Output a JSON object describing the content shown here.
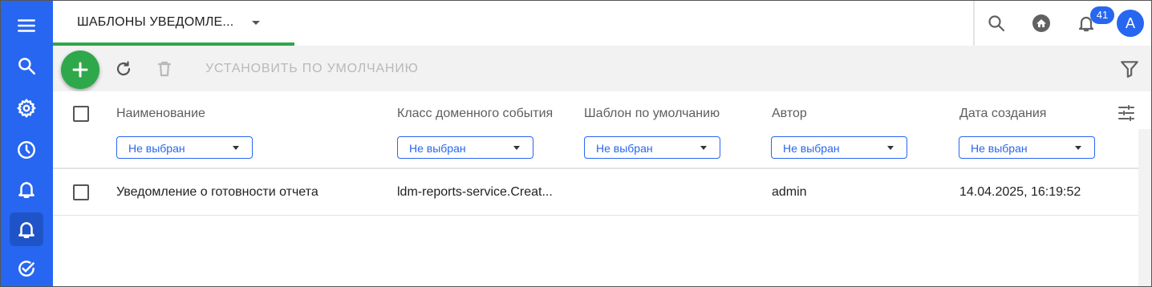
{
  "topbar": {
    "tab_label": "ШАБЛОНЫ УВЕДОМЛЕ...",
    "notification_count": "41",
    "avatar_initial": "A"
  },
  "sidebar": {
    "items": [
      {
        "icon": "menu-icon"
      },
      {
        "icon": "search-icon"
      },
      {
        "icon": "gear-icon"
      },
      {
        "icon": "clock-icon"
      },
      {
        "icon": "bell-icon"
      },
      {
        "icon": "bell-icon",
        "active": true
      },
      {
        "icon": "check-circle-icon"
      }
    ]
  },
  "toolbar": {
    "set_default_label": "УСТАНОВИТЬ ПО УМОЛЧАНИЮ"
  },
  "table": {
    "columns": [
      {
        "title": "Наименование",
        "filter": "Не выбран"
      },
      {
        "title": "Класс доменного события",
        "filter": "Не выбран"
      },
      {
        "title": "Шаблон по умолчанию",
        "filter": "Не выбран"
      },
      {
        "title": "Автор",
        "filter": "Не выбран"
      },
      {
        "title": "Дата создания",
        "filter": "Не выбран"
      }
    ],
    "rows": [
      {
        "name": "Уведомление о готовности отчета",
        "event_class": "ldm-reports-service.Creat...",
        "default_template": "",
        "author": "admin",
        "created": "14.04.2025, 16:19:52"
      }
    ]
  },
  "colors": {
    "accent": "#2766f0",
    "fab": "#2ea84a",
    "tab_underline": "#2ea84a",
    "toolbar_bg": "#f2f2f2"
  }
}
